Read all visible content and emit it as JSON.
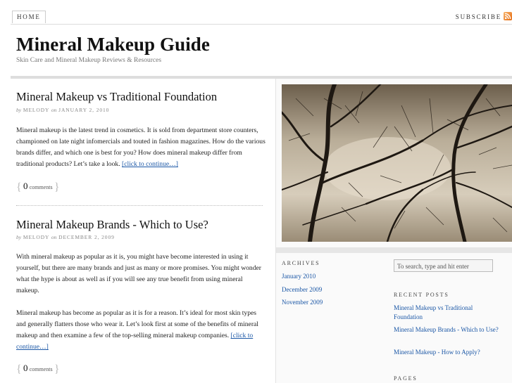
{
  "nav": {
    "home": "HOME",
    "subscribe": "SUBSCRIBE"
  },
  "header": {
    "title": "Mineral Makeup Guide",
    "tagline": "Skin Care and Mineral Makeup Reviews & Resources"
  },
  "posts": [
    {
      "title": "Mineral Makeup vs Traditional Foundation",
      "by": "by",
      "author": "MELODY",
      "on": "on",
      "date": "JANUARY 2, 2010",
      "paragraphs": [
        "Mineral makeup is the latest trend in cosmetics. It is sold from department store counters, championed on late night infomercials and touted in fashion magazines. How do the various brands differ, and which one is best for you? How does mineral makeup differ from traditional products? Let’s take a look."
      ],
      "more": "[click to continue…]",
      "comment_count": "0",
      "comment_word": "comments"
    },
    {
      "title": "Mineral Makeup Brands - Which to Use?",
      "by": "by",
      "author": "MELODY",
      "on": "on",
      "date": "DECEMBER 2, 2009",
      "paragraphs": [
        "With mineral makeup as popular as it is, you might have become interested in using it yourself, but there are many brands and just as many or more promises. You might wonder what the hype is about as well as if you will see any true benefit from using mineral makeup.",
        "Mineral makeup has become as popular as it is for a reason. It’s ideal for most skin types and generally flatters those who wear it. Let’s look first at some of the benefits of mineral makeup and then examine a few of the top-selling mineral makeup companies."
      ],
      "more": "[click to continue…]",
      "comment_count": "0",
      "comment_word": "comments"
    }
  ],
  "sidebar": {
    "archives_title": "Archives",
    "archives": [
      "January 2010",
      "December 2009",
      "November 2009"
    ],
    "search_placeholder": "To search, type and hit enter",
    "recent_title": "Recent Posts",
    "recent": [
      "Mineral Makeup vs Traditional Foundation",
      "Mineral Makeup Brands - Which to Use?",
      "Mineral Makeup - How to Apply?"
    ],
    "pages_title": "Pages"
  },
  "icons": {
    "rss": "rss-feed-icon"
  },
  "colors": {
    "link": "#1b57a6",
    "rss": "#e56b12"
  }
}
